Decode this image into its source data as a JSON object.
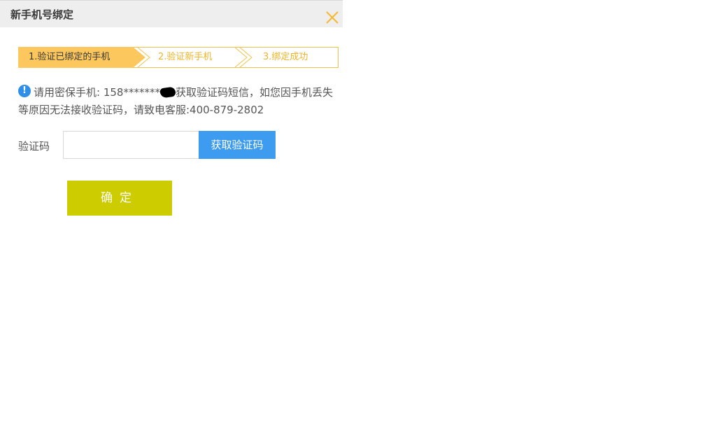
{
  "dialog": {
    "title": "新手机号绑定",
    "close_icon": "close-icon"
  },
  "steps": [
    {
      "label": "1.验证已绑定的手机",
      "state": "active"
    },
    {
      "label": "2.验证新手机",
      "state": "pending"
    },
    {
      "label": "3.绑定成功",
      "state": "pending"
    }
  ],
  "notice": {
    "icon": "info-icon",
    "icon_glyph": "!",
    "text_before": "请用密保手机: 158*******",
    "text_after": "获取验证码短信，如您因手机丢失等原因无法接收验证码，请致电客服:400-879-2802"
  },
  "form": {
    "code_label": "验证码",
    "code_value": "",
    "code_placeholder": "",
    "get_code_label": "获取验证码",
    "confirm_label": "确定"
  },
  "colors": {
    "step_active_bg": "#fcc75c",
    "step_border": "#f0c24b",
    "step_pending_text": "#f0b429",
    "get_code_bg": "#3d9cf0",
    "confirm_bg": "#cccc00",
    "close_icon": "#f5b82e"
  }
}
